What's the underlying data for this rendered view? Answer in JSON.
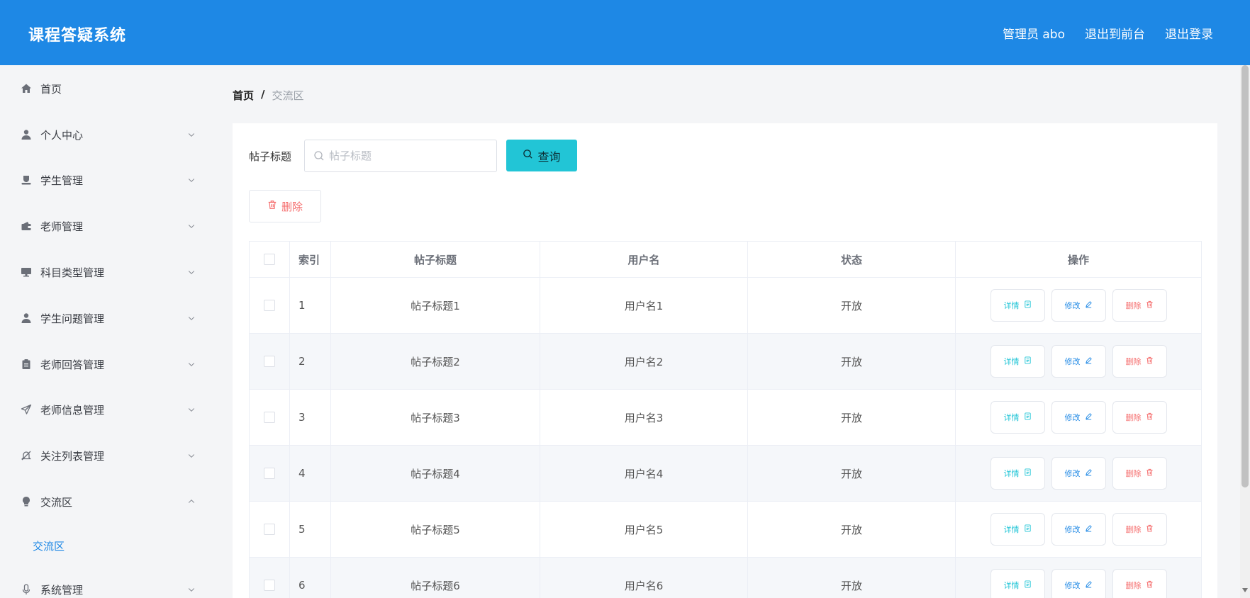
{
  "header": {
    "brand": "课程答疑系统",
    "nav": [
      "管理员 abo",
      "退出到前台",
      "退出登录"
    ]
  },
  "sidebar": {
    "items": [
      {
        "label": "首页",
        "icon": "home-icon",
        "expandable": false
      },
      {
        "label": "个人中心",
        "icon": "user-icon",
        "expandable": true
      },
      {
        "label": "学生管理",
        "icon": "student-icon",
        "expandable": true
      },
      {
        "label": "老师管理",
        "icon": "wallet-icon",
        "expandable": true
      },
      {
        "label": "科目类型管理",
        "icon": "monitor-icon",
        "expandable": true
      },
      {
        "label": "学生问题管理",
        "icon": "person-icon",
        "expandable": true
      },
      {
        "label": "老师回答管理",
        "icon": "clipboard-icon",
        "expandable": true
      },
      {
        "label": "老师信息管理",
        "icon": "send-icon",
        "expandable": true
      },
      {
        "label": "关注列表管理",
        "icon": "bell-off-icon",
        "expandable": true
      },
      {
        "label": "交流区",
        "icon": "bulb-icon",
        "expandable": true,
        "expanded": true
      },
      {
        "label": "系统管理",
        "icon": "microphone-icon",
        "expandable": true
      }
    ],
    "submenu": {
      "label": "交流区"
    }
  },
  "breadcrumb": {
    "home": "首页",
    "separator": "/",
    "current": "交流区"
  },
  "search": {
    "label": "帖子标题",
    "placeholder": "帖子标题",
    "value": "",
    "button_label": "查询"
  },
  "toolbar": {
    "delete_label": "删除"
  },
  "table": {
    "columns": [
      "索引",
      "帖子标题",
      "用户名",
      "状态",
      "操作"
    ],
    "actions": {
      "detail": "详情",
      "edit": "修改",
      "delete": "删除"
    },
    "rows": [
      {
        "index": "1",
        "title": "帖子标题1",
        "user": "用户名1",
        "status": "开放"
      },
      {
        "index": "2",
        "title": "帖子标题2",
        "user": "用户名2",
        "status": "开放"
      },
      {
        "index": "3",
        "title": "帖子标题3",
        "user": "用户名3",
        "status": "开放"
      },
      {
        "index": "4",
        "title": "帖子标题4",
        "user": "用户名4",
        "status": "开放"
      },
      {
        "index": "5",
        "title": "帖子标题5",
        "user": "用户名5",
        "status": "开放"
      },
      {
        "index": "6",
        "title": "帖子标题6",
        "user": "用户名6",
        "status": "开放"
      }
    ]
  },
  "colors": {
    "header_bg": "#1e88e5",
    "accent_cyan": "#22c5d6",
    "danger": "#f56c6c",
    "link_blue": "#1e88e5"
  }
}
